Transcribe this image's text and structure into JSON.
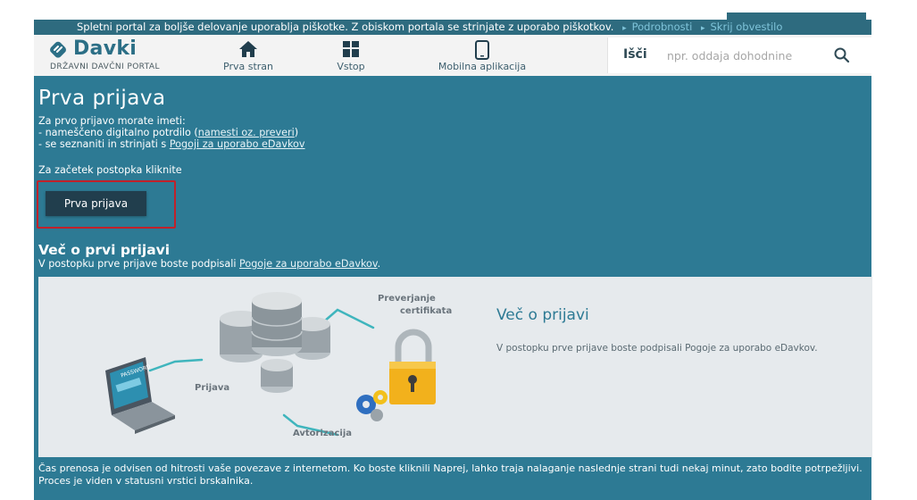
{
  "cookie": {
    "message": "Spletni portal za boljše delovanje uporablja piškotke. Z obiskom portala se strinjate z uporabo piškotkov.",
    "details_link": "Podrobnosti",
    "hide_link": "Skrij obvestilo"
  },
  "header": {
    "logo_name": "Davki",
    "logo_subtitle": "DRŽAVNI DAVČNI PORTAL",
    "nav": [
      {
        "label": "Prva stran",
        "icon": "home-icon"
      },
      {
        "label": "Vstop",
        "icon": "grid-icon"
      },
      {
        "label": "Mobilna aplikacija",
        "icon": "mobile-icon"
      }
    ],
    "search": {
      "label": "Išči",
      "placeholder": "npr. oddaja dohodnine",
      "icon": "search-icon"
    }
  },
  "main": {
    "title": "Prva prijava",
    "requirements_intro": "Za prvo prijavo morate imeti:",
    "req1_prefix": "- nameščeno digitalno potrdilo (",
    "req1_link": "namesti oz. preveri",
    "req1_suffix": ")",
    "req2_prefix": "- se seznaniti in strinjati s ",
    "req2_link": "Pogoji za uporabo eDavkov",
    "start_text": "Za začetek postopka kliknite",
    "button_label": "Prva prijava",
    "more_title": "Več o prvi prijavi",
    "more_prefix": "V postopku prve prijave boste podpisali ",
    "more_link": "Pogoje za uporabo eDavkov",
    "more_suffix": ".",
    "panel": {
      "title": "Več o prijavi",
      "text": "V postopku prve prijave boste podpisali Pogoje za uporabo eDavkov.",
      "illustration": {
        "label_verify": "Preverjanje certifikata",
        "label_login": "Prijava",
        "label_auth": "Avtorizacija",
        "laptop_text": "PASSWORD"
      }
    },
    "footnote": "Čas prenosa je odvisen od hitrosti vaše povezave z internetom. Ko boste kliknili Naprej, lahko traja nalaganje naslednje strani tudi nekaj minut, zato bodite potrpežljivi. Proces je viden v statusni vrstici brskalnika."
  },
  "colors": {
    "teal": "#2d7a94",
    "dark_button": "#213e4d",
    "highlight_red": "#c0212a"
  }
}
